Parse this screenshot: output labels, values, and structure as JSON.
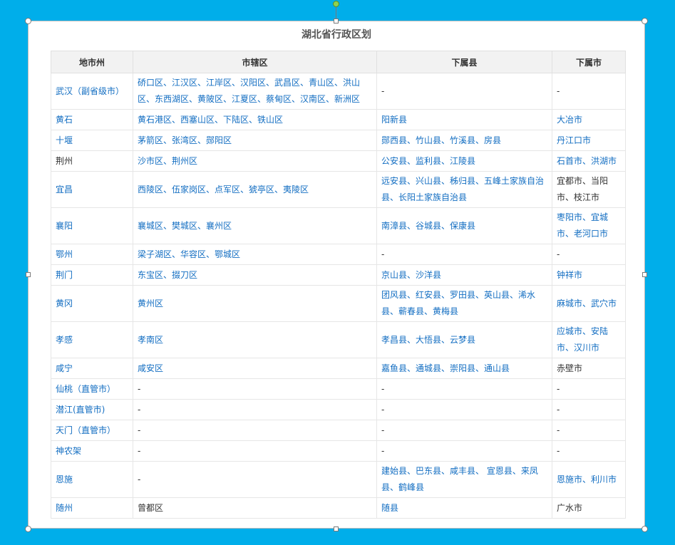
{
  "title": "湖北省行政区划",
  "headers": [
    "地市州",
    "市辖区",
    "下属县",
    "下属市"
  ],
  "rows": [
    {
      "city": "武汉（副省级市）",
      "districts": "硚口区、江汉区、江岸区、汉阳区、武昌区、青山区、洪山区、东西湖区、黄陂区、江夏区、蔡甸区、汉南区、新洲区",
      "counties": "-",
      "cities": "-",
      "city_link": true,
      "districts_link": true,
      "counties_link": false,
      "cities_link": false,
      "tall": true
    },
    {
      "city": "黄石",
      "districts": "黄石港区、西塞山区、下陆区、铁山区",
      "counties": "阳新县",
      "cities": "大冶市",
      "city_link": true,
      "districts_link": true,
      "counties_link": true,
      "cities_link": true,
      "tall": false
    },
    {
      "city": "十堰",
      "districts": "茅箭区、张湾区、郧阳区",
      "counties": "郧西县、竹山县、竹溪县、房县",
      "cities": "丹江口市",
      "city_link": true,
      "districts_link": true,
      "counties_link": true,
      "cities_link": true,
      "tall": false
    },
    {
      "city": "荆州",
      "districts": "沙市区、荆州区",
      "counties": "公安县、监利县、江陵县",
      "cities": "石首市、洪湖市",
      "city_link": false,
      "districts_link": true,
      "counties_link": true,
      "cities_link": true,
      "tall": false
    },
    {
      "city": "宜昌",
      "districts": "西陵区、伍家岗区、点军区、猇亭区、夷陵区",
      "counties": "远安县、兴山县、秭归县、五峰土家族自治县、长阳土家族自治县",
      "cities": "宜都市、当阳市、枝江市",
      "city_link": true,
      "districts_link": true,
      "counties_link": true,
      "cities_link": false,
      "tall": true
    },
    {
      "city": "襄阳",
      "districts": "襄城区、樊城区、襄州区",
      "counties": "南漳县、谷城县、保康县",
      "cities": "枣阳市、宜城市、老河口市",
      "city_link": true,
      "districts_link": true,
      "counties_link": true,
      "cities_link": true,
      "tall": true
    },
    {
      "city": "鄂州",
      "districts": "梁子湖区、华容区、鄂城区",
      "counties": "-",
      "cities": "-",
      "city_link": true,
      "districts_link": true,
      "counties_link": false,
      "cities_link": false,
      "tall": false
    },
    {
      "city": "荆门",
      "districts": "东宝区、掇刀区",
      "counties": "京山县、沙洋县",
      "cities": "钟祥市",
      "city_link": true,
      "districts_link": true,
      "counties_link": true,
      "cities_link": true,
      "tall": false
    },
    {
      "city": "黄冈",
      "districts": "黄州区",
      "counties": "团风县、红安县、罗田县、英山县、浠水县、蕲春县、黄梅县",
      "cities": "麻城市、武穴市",
      "city_link": true,
      "districts_link": true,
      "counties_link": true,
      "cities_link": true,
      "tall": true
    },
    {
      "city": "孝感",
      "districts": "孝南区",
      "counties": "孝昌县、大悟县、云梦县",
      "cities": "应城市、安陆市、汉川市",
      "city_link": true,
      "districts_link": true,
      "counties_link": true,
      "cities_link": true,
      "tall": true
    },
    {
      "city": "咸宁",
      "districts": "咸安区",
      "counties": "嘉鱼县、通城县、崇阳县、通山县",
      "cities": "赤壁市",
      "city_link": true,
      "districts_link": true,
      "counties_link": true,
      "cities_link": false,
      "tall": false
    },
    {
      "city": "仙桃（直管市）",
      "districts": "-",
      "counties": "-",
      "cities": "-",
      "city_link": true,
      "districts_link": false,
      "counties_link": false,
      "cities_link": false,
      "tall": false
    },
    {
      "city": "潜江(直管市)",
      "districts": "-",
      "counties": "-",
      "cities": "-",
      "city_link": true,
      "districts_link": false,
      "counties_link": false,
      "cities_link": false,
      "tall": false
    },
    {
      "city": "天门（直管市）",
      "districts": "-",
      "counties": "-",
      "cities": "-",
      "city_link": true,
      "districts_link": false,
      "counties_link": false,
      "cities_link": false,
      "tall": false
    },
    {
      "city": "神农架",
      "districts": "-",
      "counties": "-",
      "cities": "-",
      "city_link": true,
      "districts_link": false,
      "counties_link": false,
      "cities_link": false,
      "tall": false
    },
    {
      "city": "恩施",
      "districts": "-",
      "counties": "建始县、巴东县、咸丰县、 宣恩县、来凤县、鹤峰县",
      "cities": "恩施市、利川市",
      "city_link": true,
      "districts_link": false,
      "counties_link": true,
      "cities_link": true,
      "tall": true
    },
    {
      "city": "随州",
      "districts": "曾都区",
      "counties": "随县",
      "cities": "广水市",
      "city_link": true,
      "districts_link": false,
      "counties_link": true,
      "cities_link": false,
      "tall": false
    }
  ],
  "colors": {
    "background": "#00aeea",
    "link": "#136ec2",
    "header_bg": "#f2f2f2"
  }
}
